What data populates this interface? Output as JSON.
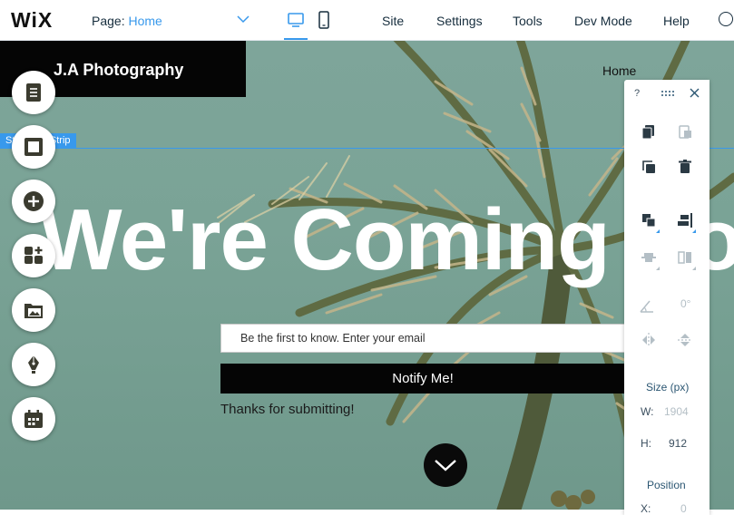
{
  "editor": {
    "logo": "WiX",
    "page_label": "Page:",
    "page_value": "Home",
    "menu": [
      "Site",
      "Settings",
      "Tools",
      "Dev Mode",
      "Help"
    ]
  },
  "site": {
    "title": "J.A Photography",
    "nav_home": "Home",
    "strip_tag": "Strip Link Strip",
    "hero": "We're Coming Soon",
    "email_placeholder": "Be the first to know. Enter your email",
    "notify_label": "Notify Me!",
    "thanks": "Thanks for submitting!"
  },
  "add_panel": {
    "tools": [
      "pages-icon",
      "strip-icon",
      "add-icon",
      "app-market-icon",
      "media-icon",
      "blog-icon",
      "bookings-icon"
    ]
  },
  "toolbar": {
    "help": "?",
    "rotation": "0°",
    "size_label": "Size (px)",
    "width_label": "W:",
    "width_value": "1904",
    "height_label": "H:",
    "height_value": "912",
    "position_label": "Position",
    "x_label": "X:",
    "x_value": "0"
  },
  "colors": {
    "accent": "#3899ec",
    "text_dark": "#162d3d",
    "muted": "#b4bfc6",
    "title_box": "#050505",
    "sky": "#7ea59a"
  }
}
